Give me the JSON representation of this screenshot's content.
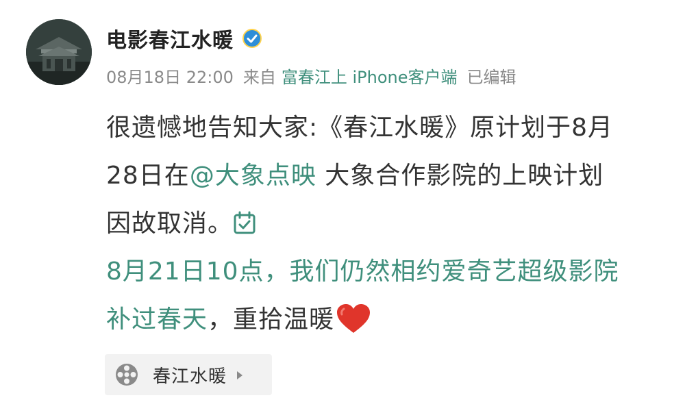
{
  "author": {
    "name": "电影春江水暖",
    "verified_icon": "verified-badge-icon",
    "avatar_icon": "building-avatar"
  },
  "meta": {
    "time": "08月18日 22:00",
    "from_label": "来自",
    "source": "富春江上 iPhone客户端",
    "edited": "已编辑"
  },
  "post": {
    "line1": "很遗憾地告知大家:《春江水暖》原计划于8月",
    "line2_prefix": "28日在",
    "mention": "@大象点映",
    "line2_suffix": " 大象合作影院的上映计划",
    "line3": "因故取消。",
    "line4": "8月21日10点，我们仍然相约爱奇艺超级影院",
    "line5_link": "补过春天",
    "line5_rest": "，重拾温暖",
    "check_icon": "calendar-check-icon",
    "heart_icon": "red-heart-emoji"
  },
  "film_chip": {
    "label": "春江水暖",
    "icon": "film-reel-icon",
    "arrow_icon": "triangle-right-icon"
  },
  "colors": {
    "accent": "#3f8f7c",
    "text": "#333333",
    "meta": "#8a8a8a",
    "verified": "#2e8ed8",
    "heart": "#e0352b"
  }
}
